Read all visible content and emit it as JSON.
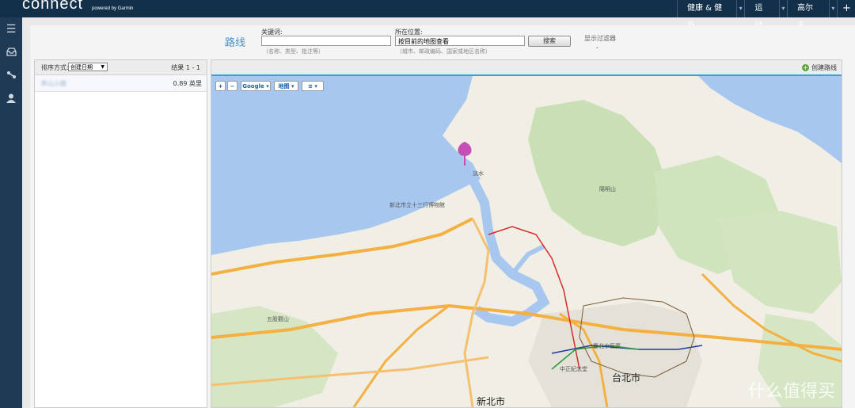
{
  "app": {
    "logo": "connect",
    "logo_sub": "powered by Garmin"
  },
  "topnav": {
    "items": [
      "健康 & 健身",
      "运动",
      "高尔夫"
    ],
    "add": "+"
  },
  "rail_icons": [
    "menu-icon",
    "inbox-icon",
    "connections-icon",
    "user-icon"
  ],
  "page": {
    "title": "路线",
    "keyword_label": "关键词:",
    "keyword_value": "",
    "keyword_hint": "（名称、类型、批注等）",
    "location_label": "所在位置:",
    "location_value": "按目前的地图查看",
    "location_hint": "（城市、邮政编码、国家或地区名称）",
    "search_button": "搜索",
    "filters_link": "显示过滤器"
  },
  "results": {
    "sort_label": "排序方式:",
    "sort_value": "创建日期",
    "count": "结果 1 - 1",
    "rows": [
      {
        "name": "新山小路",
        "distance": "0.89 英里"
      }
    ]
  },
  "map": {
    "create_route": "创建路线",
    "zoom_in": "+",
    "zoom_out": "−",
    "provider": "Google ▾",
    "map_type": "地图 ▾",
    "layers": "≋ ▾",
    "labels": {
      "city_main": "台北市",
      "city_new": "新北市",
      "harbor": "新北市立十三行博物館",
      "park": "陽明山",
      "xiaoyoukeng": "臺北小巨蛋",
      "zhongzheng": "中正紀念堂",
      "wugu": "五股觀山",
      "tamsui": "淡水"
    },
    "watermark": "什么值得买"
  },
  "colors": {
    "topbar": "#12304a",
    "rail": "#1f3a55",
    "accent": "#3aa0d8",
    "water": "#a7c7ee",
    "land": "#f0eee5",
    "mountain": "#c9dfb4",
    "road_major": "#f5b042",
    "pin": "#c64fb6"
  }
}
